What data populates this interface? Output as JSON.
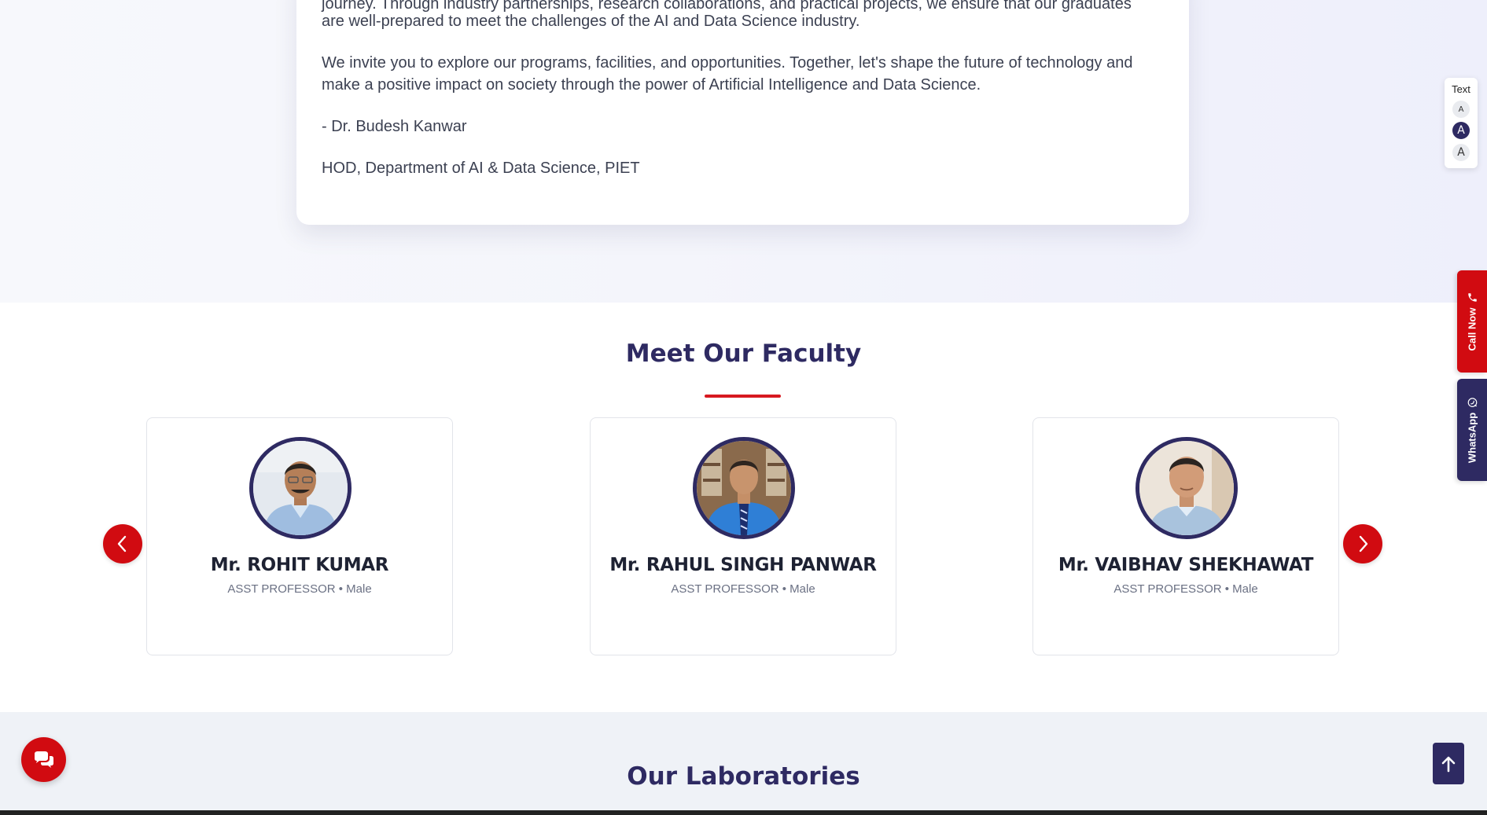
{
  "message": {
    "lines": [
      "journey. Through industry partnerships, research collaborations, and practical projects, we ensure that our graduates",
      "are well-prepared to meet the challenges of the AI and Data Science industry.",
      "We invite you to explore our programs, facilities, and opportunities. Together, let's shape the future of technology and",
      "make a positive impact on society through the power of Artificial Intelligence and Data Science."
    ],
    "signature": "- Dr. Budesh Kanwar",
    "designation": "HOD, Department of AI & Data Science, PIET"
  },
  "faculty": {
    "title": "Meet Our Faculty",
    "members": [
      {
        "name": "Mr. ROHIT KUMAR",
        "role": "ASST PROFESSOR",
        "gender": "Male",
        "meta": "ASST PROFESSOR • Male"
      },
      {
        "name": "Mr. RAHUL SINGH PANWAR",
        "role": "ASST PROFESSOR",
        "gender": "Male",
        "meta": "ASST PROFESSOR • Male"
      },
      {
        "name": "Mr. VAIBHAV SHEKHAWAT",
        "role": "ASST PROFESSOR",
        "gender": "Male",
        "meta": "ASST PROFESSOR • Male"
      }
    ],
    "prev_icon": "chevron-left-icon",
    "next_icon": "chevron-right-icon"
  },
  "labs": {
    "title": "Our Laboratories"
  },
  "widgets": {
    "text_size": {
      "label": "Text",
      "options": [
        "A",
        "A",
        "A"
      ],
      "active_index": 1
    },
    "call_now": {
      "label": "Call Now",
      "icon": "phone-icon"
    },
    "whatsapp": {
      "label": "WhatsApp",
      "icon": "whatsapp-icon"
    },
    "chat_icon": "chat-bubbles-icon",
    "scroll_top_icon": "arrow-up-icon"
  },
  "colors": {
    "brand_navy": "#2e2a62",
    "brand_red": "#d10b11",
    "underline_red": "#d71920"
  }
}
